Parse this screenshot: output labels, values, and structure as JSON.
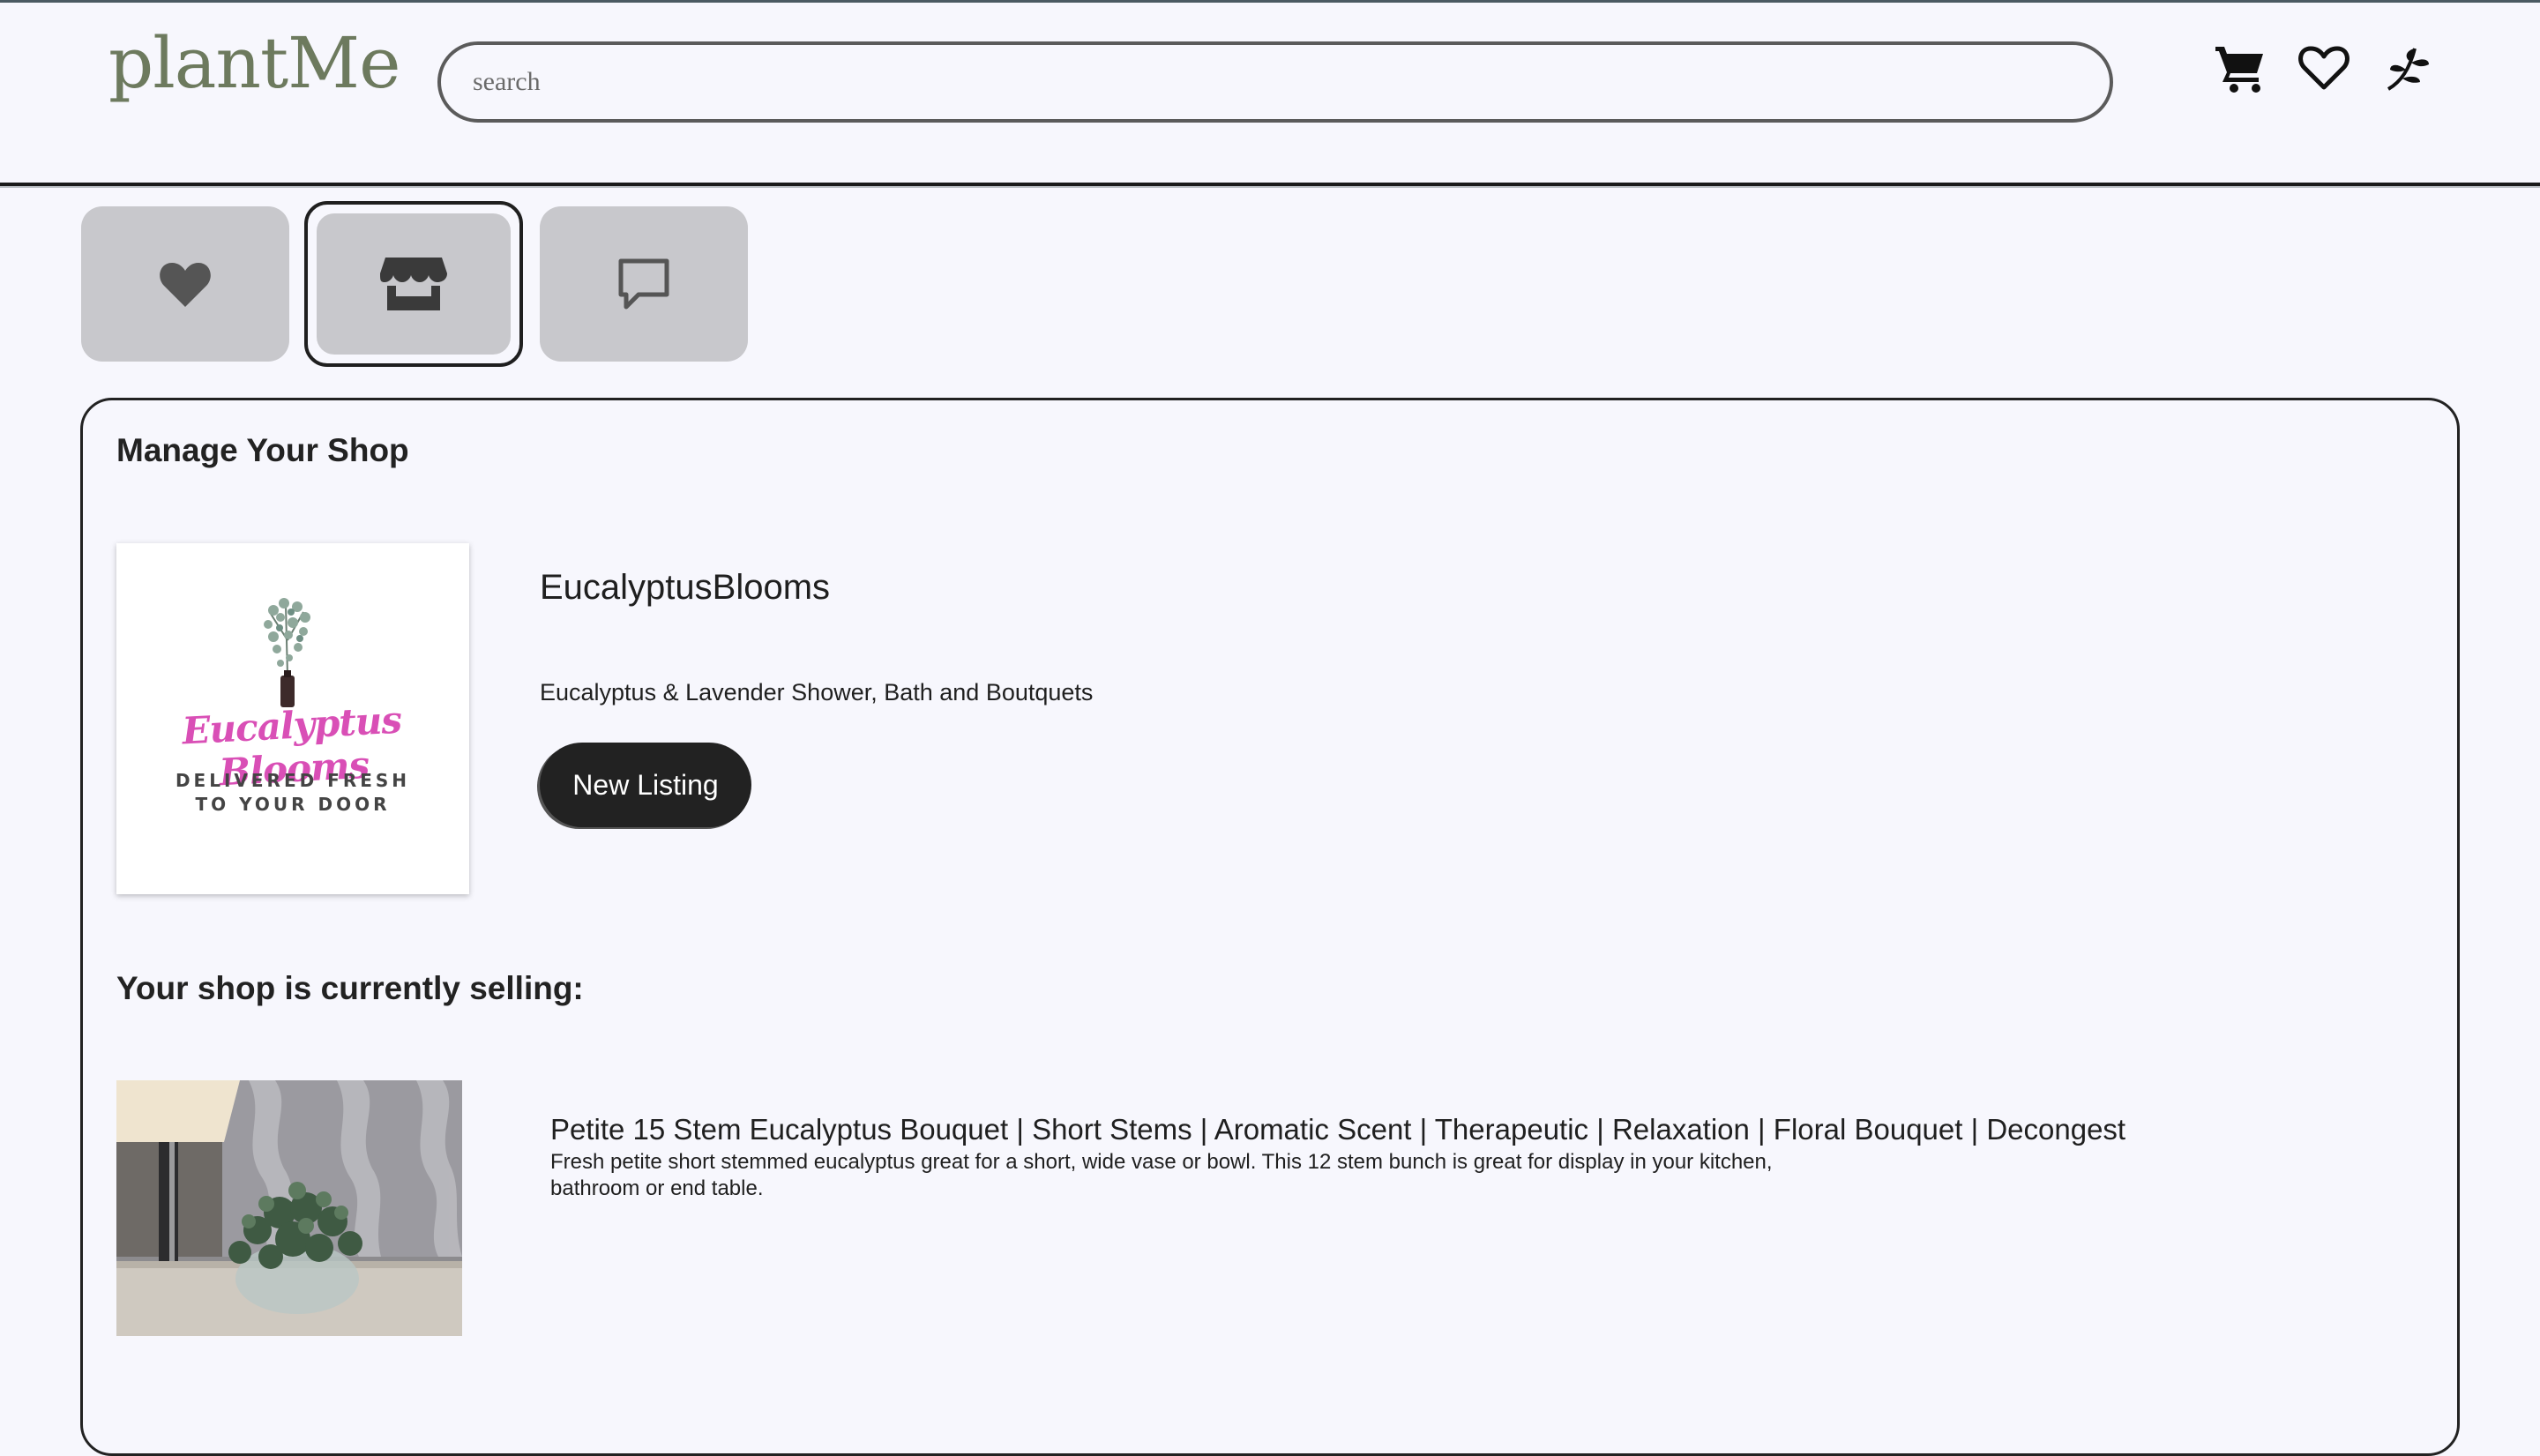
{
  "header": {
    "logo": "plantMe",
    "search_placeholder": "search",
    "icons": [
      "cart-icon",
      "heart-icon",
      "sprout-icon"
    ]
  },
  "tabs": [
    {
      "icon": "heart-icon",
      "active": false
    },
    {
      "icon": "store-icon",
      "active": true
    },
    {
      "icon": "message-icon",
      "active": false
    }
  ],
  "main": {
    "heading": "Manage Your Shop",
    "shop": {
      "name": "EucalyptusBlooms",
      "description": "Eucalyptus & Lavender Shower, Bath and Boutquets",
      "logo_script": "Eucalyptus Blooms",
      "logo_tagline": "DELIVERED FRESH\nTO YOUR DOOR"
    },
    "new_listing_label": "New Listing",
    "selling_heading": "Your shop is currently selling:",
    "listings": [
      {
        "title": "Petite 15 Stem Eucalyptus Bouquet | Short Stems | Aromatic Scent | Therapeutic | Relaxation | Floral Bouquet | Decongest",
        "description": "Fresh petite short stemmed eucalyptus great for a short, wide vase or bowl. This 12 stem bunch is great for display in your kitchen, bathroom or end table."
      }
    ]
  },
  "colors": {
    "background": "#f7f7fd",
    "logo": "#6d7a5e",
    "tab_bg": "#c8c8cc",
    "button_bg": "#222222",
    "script_pink": "#d94fb6"
  }
}
